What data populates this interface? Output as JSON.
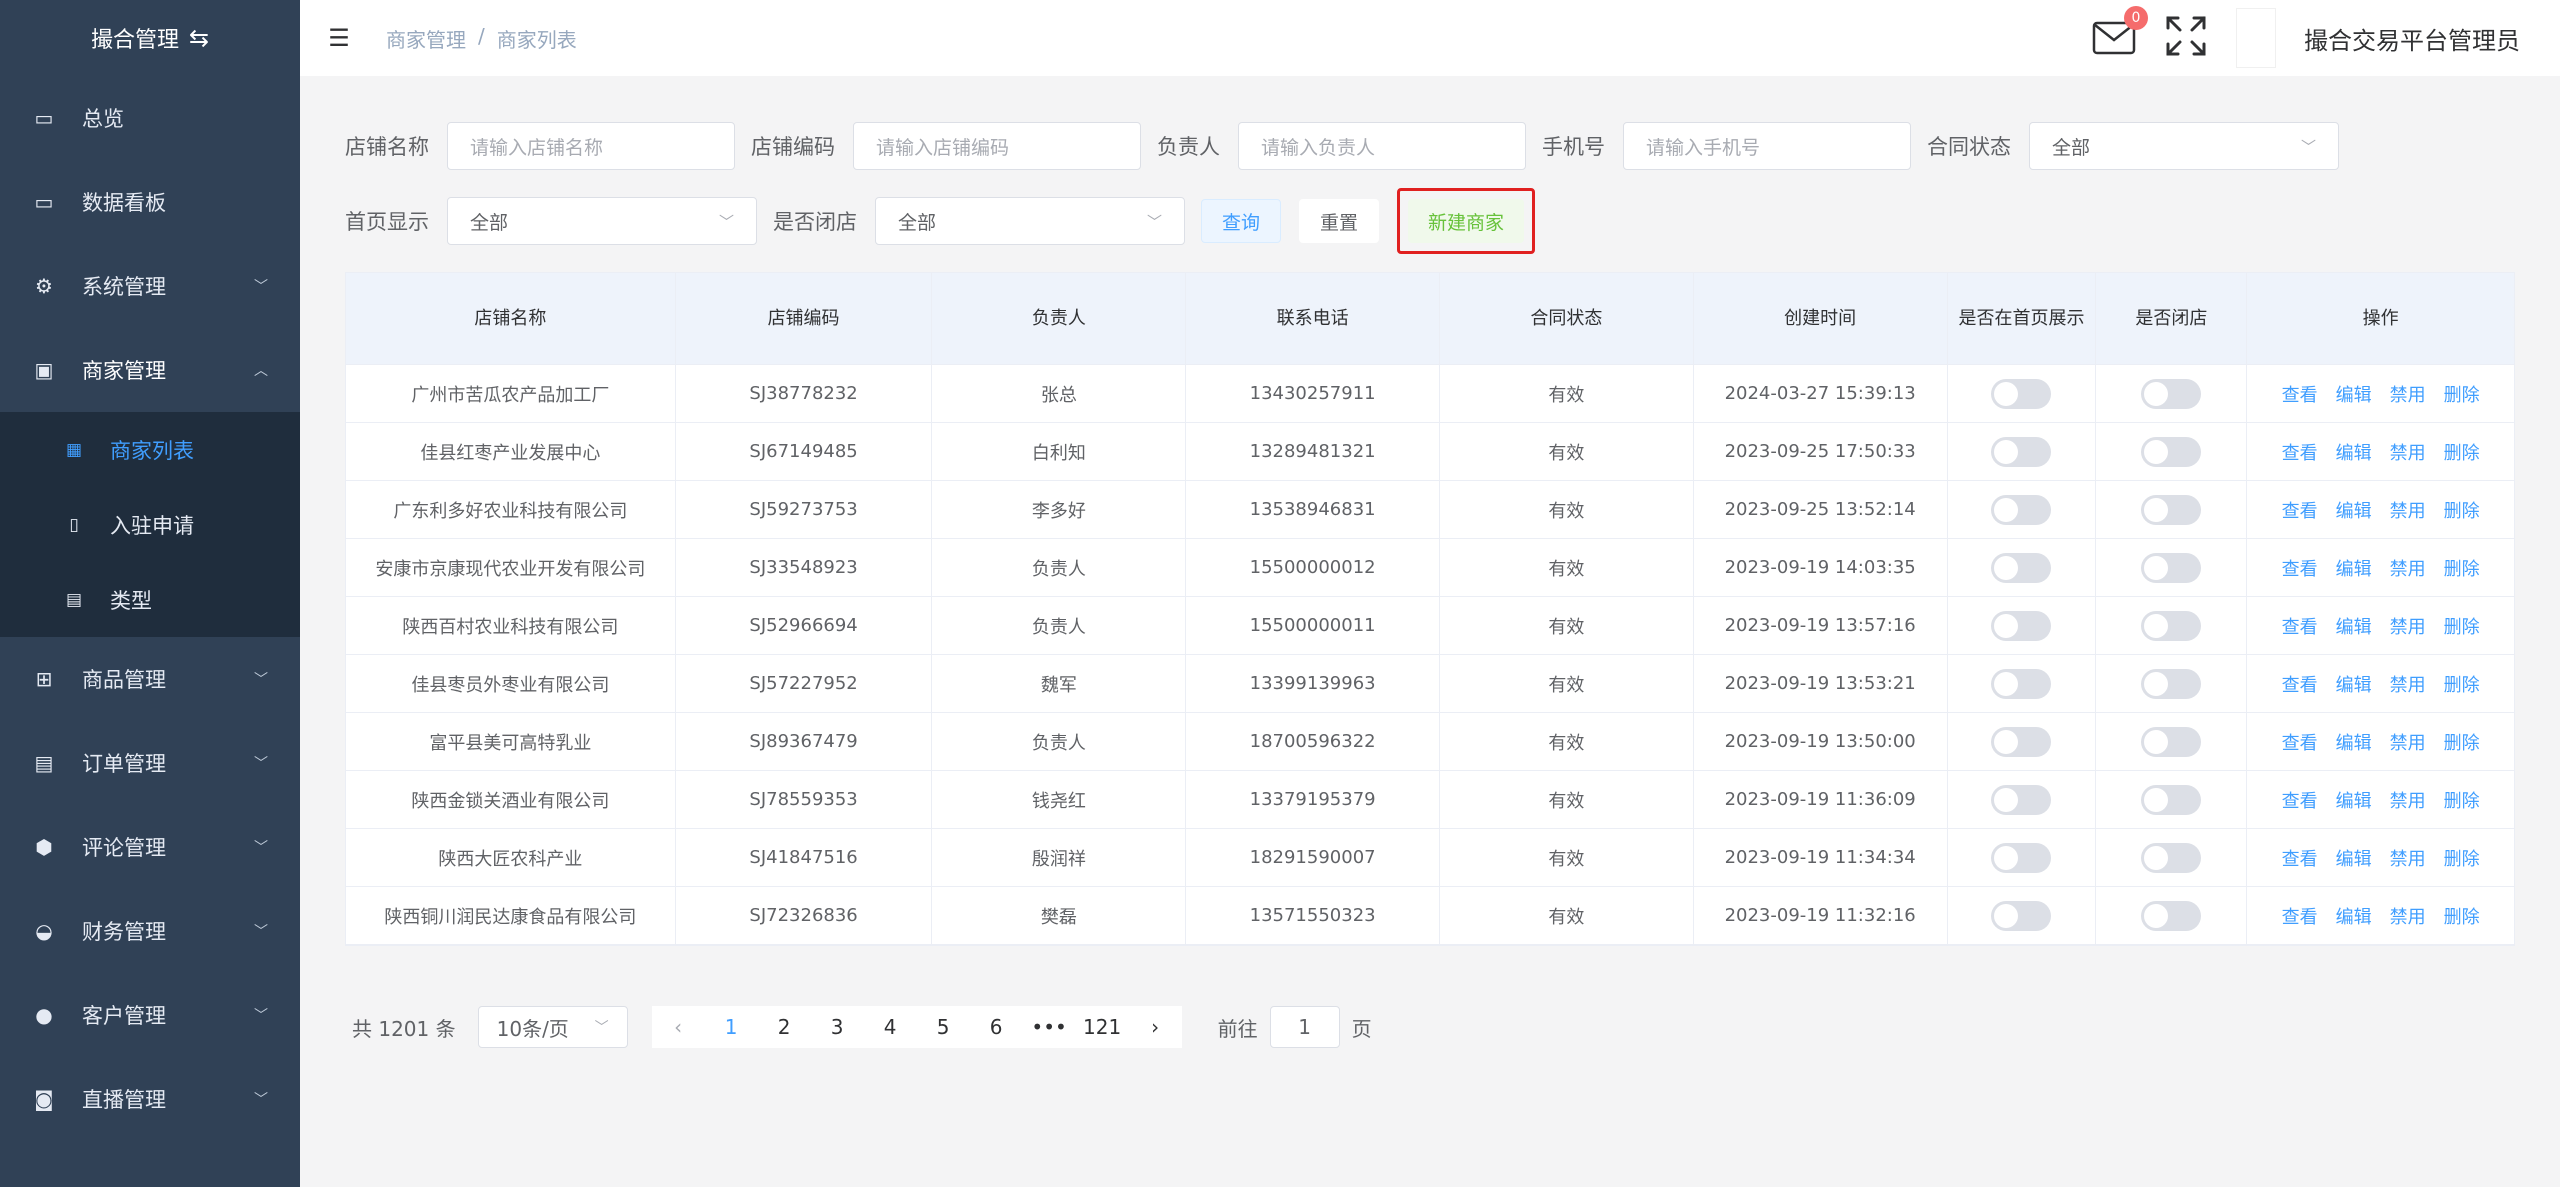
{
  "sidebar": {
    "brand": "撮合管理",
    "brand_icon": "⇆",
    "items": [
      {
        "label": "总览",
        "icon": "monitor-icon",
        "glyph": "▭"
      },
      {
        "label": "数据看板",
        "icon": "monitor-icon",
        "glyph": "▭"
      },
      {
        "label": "系统管理",
        "icon": "gear-icon",
        "glyph": "⚙"
      },
      {
        "label": "商家管理",
        "icon": "store-icon",
        "glyph": "▣"
      },
      {
        "label": "商品管理",
        "icon": "gift-icon",
        "glyph": "⊞"
      },
      {
        "label": "订单管理",
        "icon": "document-icon",
        "glyph": "▤"
      },
      {
        "label": "评论管理",
        "icon": "shield-icon",
        "glyph": "⬢"
      },
      {
        "label": "财务管理",
        "icon": "wallet-icon",
        "glyph": "◒"
      },
      {
        "label": "客户管理",
        "icon": "user-icon",
        "glyph": "●"
      },
      {
        "label": "直播管理",
        "icon": "video-icon",
        "glyph": "◙"
      }
    ],
    "submenu": [
      {
        "label": "商家列表",
        "icon": "list-icon",
        "glyph": "▦"
      },
      {
        "label": "入驻申请",
        "icon": "phone-icon",
        "glyph": "▯"
      },
      {
        "label": "类型",
        "icon": "document-icon",
        "glyph": "▤"
      }
    ]
  },
  "header": {
    "hamburger": "☰",
    "breadcrumb": [
      "商家管理",
      "/",
      "商家列表"
    ],
    "mail_count": "0",
    "user_name": "撮合交易平台管理员"
  },
  "filters": {
    "shop_name_label": "店铺名称",
    "shop_name_placeholder": "请输入店铺名称",
    "shop_code_label": "店铺编码",
    "shop_code_placeholder": "请输入店铺编码",
    "owner_label": "负责人",
    "owner_placeholder": "请输入负责人",
    "phone_label": "手机号",
    "phone_placeholder": "请输入手机号",
    "contract_label": "合同状态",
    "contract_value": "全部",
    "homepage_label": "首页显示",
    "homepage_value": "全部",
    "closed_label": "是否闭店",
    "closed_value": "全部",
    "query_label": "查询",
    "reset_label": "重置",
    "new_label": "新建商家"
  },
  "table": {
    "headers": [
      "店铺名称",
      "店铺编码",
      "负责人",
      "联系电话",
      "合同状态",
      "创建时间",
      "是否在首页展示",
      "是否闭店",
      "操作"
    ],
    "ops": [
      "查看",
      "编辑",
      "禁用",
      "删除"
    ],
    "rows": [
      {
        "name": "广州市苦瓜农产品加工厂",
        "code": "SJ38778232",
        "owner": "张总",
        "phone": "13430257911",
        "status": "有效",
        "created": "2024-03-27 15:39:13"
      },
      {
        "name": "佳县红枣产业发展中心",
        "code": "SJ67149485",
        "owner": "白利知",
        "phone": "13289481321",
        "status": "有效",
        "created": "2023-09-25 17:50:33"
      },
      {
        "name": "广东利多好农业科技有限公司",
        "code": "SJ59273753",
        "owner": "李多好",
        "phone": "13538946831",
        "status": "有效",
        "created": "2023-09-25 13:52:14"
      },
      {
        "name": "安康市京康现代农业开发有限公司",
        "code": "SJ33548923",
        "owner": "负责人",
        "phone": "15500000012",
        "status": "有效",
        "created": "2023-09-19 14:03:35"
      },
      {
        "name": "陕西百村农业科技有限公司",
        "code": "SJ52966694",
        "owner": "负责人",
        "phone": "15500000011",
        "status": "有效",
        "created": "2023-09-19 13:57:16"
      },
      {
        "name": "佳县枣员外枣业有限公司",
        "code": "SJ57227952",
        "owner": "魏军",
        "phone": "13399139963",
        "status": "有效",
        "created": "2023-09-19 13:53:21"
      },
      {
        "name": "富平县美可高特乳业",
        "code": "SJ89367479",
        "owner": "负责人",
        "phone": "18700596322",
        "status": "有效",
        "created": "2023-09-19 13:50:00"
      },
      {
        "name": "陕西金锁关酒业有限公司",
        "code": "SJ78559353",
        "owner": "钱尧红",
        "phone": "13379195379",
        "status": "有效",
        "created": "2023-09-19 11:36:09"
      },
      {
        "name": "陕西大匠农科产业",
        "code": "SJ41847516",
        "owner": "殷润祥",
        "phone": "18291590007",
        "status": "有效",
        "created": "2023-09-19 11:34:34"
      },
      {
        "name": "陕西铜川润民达康食品有限公司",
        "code": "SJ72326836",
        "owner": "樊磊",
        "phone": "13571550323",
        "status": "有效",
        "created": "2023-09-19 11:32:16"
      }
    ]
  },
  "pagination": {
    "total": "共 1201 条",
    "page_size": "10条/页",
    "pages": [
      "1",
      "2",
      "3",
      "4",
      "5",
      "6",
      "•••",
      "121"
    ],
    "active": "1",
    "goto_prefix": "前往",
    "goto_value": "1",
    "goto_suffix": "页"
  }
}
